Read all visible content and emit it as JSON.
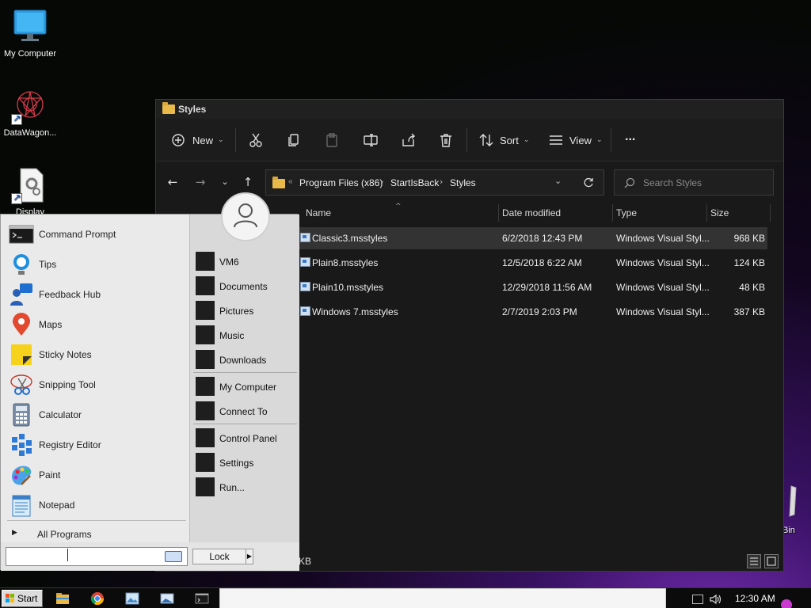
{
  "desktop": {
    "icons": [
      {
        "label": "My Computer",
        "icon": "monitor-icon"
      },
      {
        "label": "DataWagon...",
        "icon": "datawagon-icon"
      },
      {
        "label": "Display",
        "icon": "settings-file-icon"
      },
      {
        "label": "Bin",
        "icon": "recycle-bin-icon"
      }
    ]
  },
  "explorer": {
    "title": "Styles",
    "toolbar": {
      "new_label": "New",
      "sort_label": "Sort",
      "view_label": "View",
      "more_label": "..."
    },
    "address": {
      "overflow": "«",
      "segments": [
        "Program Files (x86)",
        "StartIsBack",
        "Styles"
      ]
    },
    "search": {
      "placeholder": "Search Styles"
    },
    "columns": {
      "name": "Name",
      "date": "Date modified",
      "type": "Type",
      "size": "Size"
    },
    "files": [
      {
        "name": "Classic3.msstyles",
        "date": "6/2/2018 12:43 PM",
        "type": "Windows Visual Styl...",
        "size": "968 KB"
      },
      {
        "name": "Plain8.msstyles",
        "date": "12/5/2018 6:22 AM",
        "type": "Windows Visual Styl...",
        "size": "124 KB"
      },
      {
        "name": "Plain10.msstyles",
        "date": "12/29/2018 11:56 AM",
        "type": "Windows Visual Styl...",
        "size": "48 KB"
      },
      {
        "name": "Windows 7.msstyles",
        "date": "2/7/2019 2:03 PM",
        "type": "Windows Visual Styl...",
        "size": "387 KB"
      }
    ],
    "status": "KB"
  },
  "startmenu": {
    "programs": [
      {
        "label": "Command Prompt",
        "icon": "command-prompt-icon"
      },
      {
        "label": "Tips",
        "icon": "tips-icon"
      },
      {
        "label": "Feedback Hub",
        "icon": "feedback-hub-icon"
      },
      {
        "label": "Maps",
        "icon": "maps-icon"
      },
      {
        "label": "Sticky Notes",
        "icon": "sticky-notes-icon"
      },
      {
        "label": "Snipping Tool",
        "icon": "snipping-tool-icon"
      },
      {
        "label": "Calculator",
        "icon": "calculator-icon"
      },
      {
        "label": "Registry Editor",
        "icon": "registry-editor-icon"
      },
      {
        "label": "Paint",
        "icon": "paint-icon"
      },
      {
        "label": "Notepad",
        "icon": "notepad-icon"
      }
    ],
    "all_programs": "All Programs",
    "places": {
      "group1": [
        "VM6",
        "Documents",
        "Pictures",
        "Music",
        "Downloads"
      ],
      "group2": [
        "My Computer",
        "Connect To"
      ],
      "group3": [
        "Control Panel",
        "Settings",
        "Run..."
      ]
    },
    "lock_label": "Lock"
  },
  "taskbar": {
    "start_label": "Start",
    "clock": "12:30 AM",
    "pinned": [
      "file-explorer-icon",
      "chrome-icon",
      "photos-icon",
      "image-viewer-icon",
      "terminal-icon"
    ]
  },
  "colors": {
    "explorer_bg": "#191919",
    "selected_row": "#333333",
    "startmenu_bg": "#eeeeee",
    "folder": "#e9b949"
  }
}
